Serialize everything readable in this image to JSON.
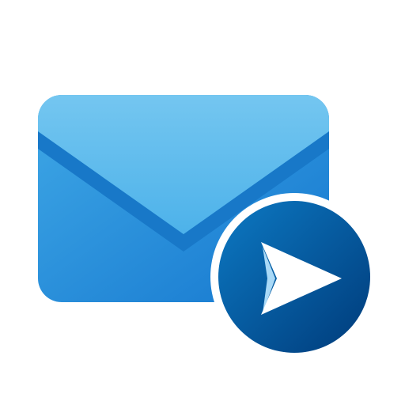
{
  "icon": {
    "main": "envelope-icon",
    "badge": "send-arrow-icon"
  },
  "colors": {
    "background": "#ffffff",
    "envelope_light": "#74C6F0",
    "envelope_mid": "#3FA8E6",
    "envelope_dark": "#1577CF",
    "envelope_fold": "#1878C8",
    "badge_light": "#0C79C3",
    "badge_dark": "#003B7A",
    "badge_ring": "#ffffff",
    "arrow": "#ffffff",
    "arrow_shade": "#A9D9F7"
  }
}
